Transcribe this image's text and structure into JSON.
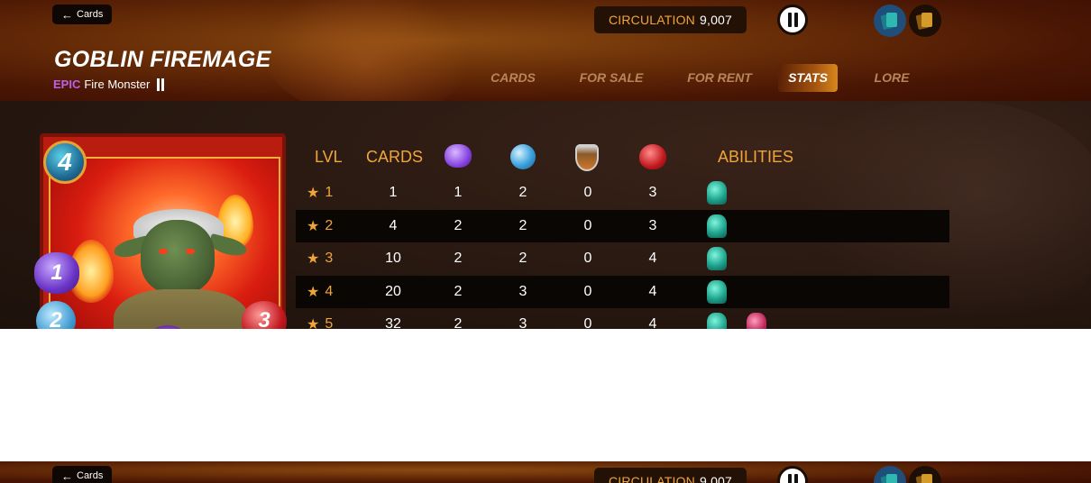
{
  "header": {
    "back_label": "Cards",
    "circulation_label": "CIRCULATION",
    "circulation_value": "9,007",
    "card_name": "GOBLIN FIREMAGE",
    "rarity": "EPIC",
    "type_text": "Fire Monster",
    "tabs": [
      {
        "label": "CARDS",
        "active": false
      },
      {
        "label": "FOR SALE",
        "active": false
      },
      {
        "label": "FOR RENT",
        "active": false
      },
      {
        "label": "STATS",
        "active": true
      },
      {
        "label": "LORE",
        "active": false
      }
    ],
    "icons": {
      "edition": "edition-icon",
      "regular_foil": "regular-foil-icon",
      "gold_foil": "gold-foil-icon"
    }
  },
  "card": {
    "mana": "4",
    "magic": "1",
    "speed": "2",
    "health": "3"
  },
  "stats": {
    "headers": {
      "lvl": "LVL",
      "cards": "CARDS",
      "abilities": "ABILITIES"
    },
    "rows": [
      {
        "lvl": "1",
        "cards": "1",
        "magic": "1",
        "speed": "2",
        "armor": "0",
        "health": "3",
        "abilities": 1
      },
      {
        "lvl": "2",
        "cards": "4",
        "magic": "2",
        "speed": "2",
        "armor": "0",
        "health": "3",
        "abilities": 1
      },
      {
        "lvl": "3",
        "cards": "10",
        "magic": "2",
        "speed": "2",
        "armor": "0",
        "health": "4",
        "abilities": 1
      },
      {
        "lvl": "4",
        "cards": "20",
        "magic": "2",
        "speed": "3",
        "armor": "0",
        "health": "4",
        "abilities": 1
      },
      {
        "lvl": "5",
        "cards": "32",
        "magic": "2",
        "speed": "3",
        "armor": "0",
        "health": "4",
        "abilities": 2
      }
    ],
    "star": "★"
  },
  "colors": {
    "accent": "#f0a53a",
    "rarity": "#c05ee8",
    "active_tab": "#d8871c"
  }
}
